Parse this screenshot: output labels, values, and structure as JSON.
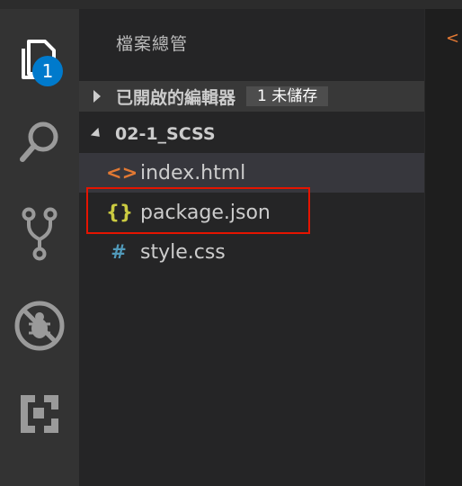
{
  "activity_bar": {
    "items": [
      {
        "name": "explorer-icon"
      },
      {
        "name": "search-icon"
      },
      {
        "name": "source-control-icon"
      },
      {
        "name": "debug-icon"
      },
      {
        "name": "extensions-icon"
      }
    ],
    "explorer_badge": "1"
  },
  "sidebar": {
    "title": "檔案總管",
    "open_editors": {
      "label": "已開啟的編輯器",
      "unsaved_badge": "1 未儲存"
    },
    "folder": {
      "label": "02-1_SCSS",
      "files": [
        {
          "icon": "<>",
          "icon_name": "html-file-icon",
          "color": "#e37933",
          "label": "index.html"
        },
        {
          "icon": "{}",
          "icon_name": "json-file-icon",
          "color": "#cbcb41",
          "label": "package.json"
        },
        {
          "icon": "#",
          "icon_name": "css-file-icon",
          "color": "#519aba",
          "label": "style.css"
        }
      ]
    }
  },
  "editor": {
    "tab_icon": "<"
  },
  "colors": {
    "activity_bar": "#333333",
    "sidebar": "#252526",
    "badge": "#007acc",
    "highlight": "#e51400"
  }
}
